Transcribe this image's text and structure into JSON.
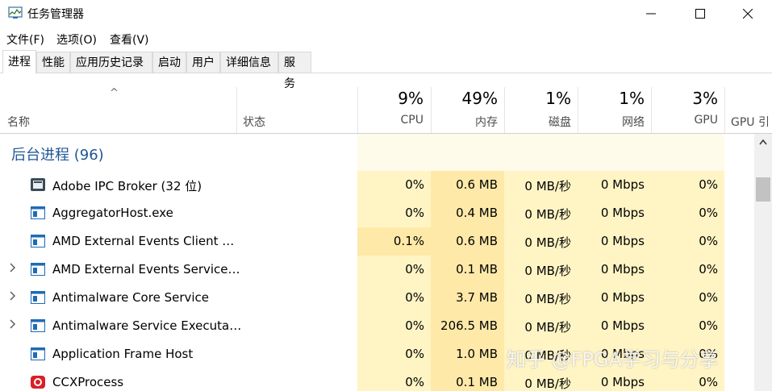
{
  "window": {
    "title": "任务管理器"
  },
  "menu": [
    "文件(F)",
    "选项(O)",
    "查看(V)"
  ],
  "tabs": [
    "进程",
    "性能",
    "应用历史记录",
    "启动",
    "用户",
    "详细信息",
    "服务"
  ],
  "header": {
    "name": "名称",
    "status": "状态",
    "cpu": {
      "pct": "9%",
      "label": "CPU"
    },
    "mem": {
      "pct": "49%",
      "label": "内存"
    },
    "disk": {
      "pct": "1%",
      "label": "磁盘"
    },
    "net": {
      "pct": "1%",
      "label": "网络"
    },
    "gpu": {
      "pct": "3%",
      "label": "GPU"
    },
    "gpu_engine": "GPU 引"
  },
  "group": "后台进程 (96)",
  "rows": [
    {
      "name": "Adobe IPC Broker (32 位)",
      "cpu": "0%",
      "mem": "0.6 MB",
      "disk": "0 MB/秒",
      "net": "0 Mbps",
      "gpu": "0%",
      "icon": "adobe-icon",
      "expand": ""
    },
    {
      "name": "AggregatorHost.exe",
      "cpu": "0%",
      "mem": "0.4 MB",
      "disk": "0 MB/秒",
      "net": "0 Mbps",
      "gpu": "0%",
      "icon": "app-window-icon",
      "expand": ""
    },
    {
      "name": "AMD External Events Client …",
      "cpu": "0.1%",
      "mem": "0.6 MB",
      "disk": "0 MB/秒",
      "net": "0 Mbps",
      "gpu": "0%",
      "icon": "app-window-icon",
      "expand": ""
    },
    {
      "name": "AMD External Events Service…",
      "cpu": "0%",
      "mem": "0.1 MB",
      "disk": "0 MB/秒",
      "net": "0 Mbps",
      "gpu": "0%",
      "icon": "app-window-icon",
      "expand": ">"
    },
    {
      "name": "Antimalware Core Service",
      "cpu": "0%",
      "mem": "3.7 MB",
      "disk": "0 MB/秒",
      "net": "0 Mbps",
      "gpu": "0%",
      "icon": "app-window-icon",
      "expand": ">"
    },
    {
      "name": "Antimalware Service Executa…",
      "cpu": "0%",
      "mem": "206.5 MB",
      "disk": "0 MB/秒",
      "net": "0 Mbps",
      "gpu": "0%",
      "icon": "app-window-icon",
      "expand": ">"
    },
    {
      "name": "Application Frame Host",
      "cpu": "0%",
      "mem": "1.0 MB",
      "disk": "0 MB/秒",
      "net": "0 Mbps",
      "gpu": "0%",
      "icon": "app-window-icon",
      "expand": ""
    },
    {
      "name": "CCXProcess",
      "cpu": "0%",
      "mem": "0.1 MB",
      "disk": "0 MB/秒",
      "net": "0 Mbps",
      "gpu": "0%",
      "icon": "creative-cloud-icon",
      "expand": ""
    }
  ],
  "watermark": "知乎 @FPGA学习与分享",
  "colors": {
    "cpu_bg": "#fff4c4",
    "cpu_hot": "#ffe9a8",
    "mem_bg": "#ffe9a8",
    "other_bg": "#fff4c4",
    "group_title": "#1f5596"
  }
}
